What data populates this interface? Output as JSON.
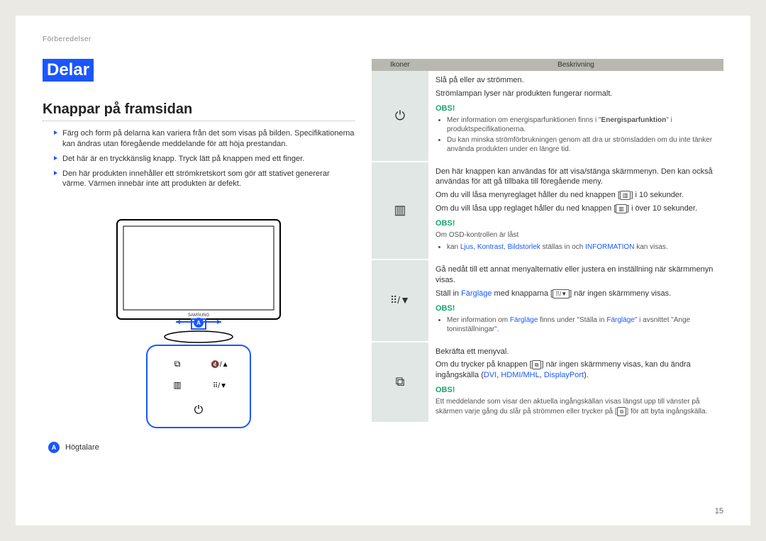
{
  "header": {
    "path": "Förberedelser"
  },
  "chapter": "Delar",
  "section_title": "Knappar på framsidan",
  "left_bullets": [
    "Färg och form på delarna kan variera från det som visas på bilden. Specifikationerna kan ändras utan föregående meddelande för att höja prestandan.",
    "Det här är en tryckkänslig knapp. Tryck lätt på knappen med ett finger.",
    "Den här produkten innehåller ett strömkretskort som gör att stativet genererar värme. Värmen innebär inte att produkten är defekt."
  ],
  "legend": {
    "marker": "A",
    "label": "Högtalare"
  },
  "table_headers": {
    "icons": "Ikoner",
    "desc": "Beskrivning"
  },
  "rows": {
    "power": {
      "line1": "Slå på eller av strömmen.",
      "line2": "Strömlampan lyser när produkten fungerar normalt.",
      "obs": "OBS!",
      "sub_pre": "Mer information om energisparfunktionen finns i \"",
      "sub_strong": "Energisparfunktion",
      "sub_post": "\" i produktspecifikationerna.",
      "sub2": "Du kan minska strömförbrukningen genom att dra ur strömsladden om du inte tänker använda produkten under en längre tid."
    },
    "menu": {
      "p1": "Den här knappen kan användas för att visa/stänga skärmmenyn. Den kan också användas för att gå tillbaka till föregående meny.",
      "p2_pre": "Om du vill låsa menyreglaget håller du ned knappen [",
      "p2_btn": "▥",
      "p2_post": "] i 10 sekunder.",
      "p3_pre": "Om du vill låsa upp reglaget håller du ned knappen [",
      "p3_btn": "▥",
      "p3_post": "] i över 10 sekunder.",
      "obs": "OBS!",
      "locked_label": "Om OSD-kontrollen är låst",
      "sub_pre": "kan ",
      "sub_links": [
        "Ljus",
        "Kontrast",
        "Bildstorlek"
      ],
      "sub_mid": " ställas in och ",
      "sub_info": "INFORMATION",
      "sub_post": " kan visas."
    },
    "nav": {
      "p1": "Gå nedåt till ett annat menyalternativ eller justera en inställning när skärmmenyn visas.",
      "p2_pre": "Ställ in ",
      "p2_link": "Färgläge",
      "p2_mid": " med knapparna [",
      "p2_btn": "⠿/▼",
      "p2_post": "] när ingen skärmmeny visas.",
      "obs": "OBS!",
      "sub_pre": "Mer information om ",
      "sub_link1": "Färgläge",
      "sub_mid": " finns under \"Ställa in ",
      "sub_link2": "Färgläge",
      "sub_post": "\" i avsnittet \"Ange toninställningar\"."
    },
    "source": {
      "p1": "Bekräfta ett menyval.",
      "p2_pre": "Om du trycker på knappen [",
      "p2_btn": "⧉",
      "p2_mid": "] när ingen skärmmeny visas, kan du ändra ingångskälla (",
      "p2_links": [
        "DVI",
        "HDMI/MHL",
        "DisplayPort"
      ],
      "p2_post": ").",
      "obs": "OBS!",
      "sub_pre": "Ett meddelande som visar den aktuella ingångskällan visas längst upp till vänster på skärmen varje gång du slår på strömmen eller trycker på [",
      "sub_btn": "⧉",
      "sub_post": "] för att byta ingångskälla."
    }
  },
  "page_number": "15"
}
